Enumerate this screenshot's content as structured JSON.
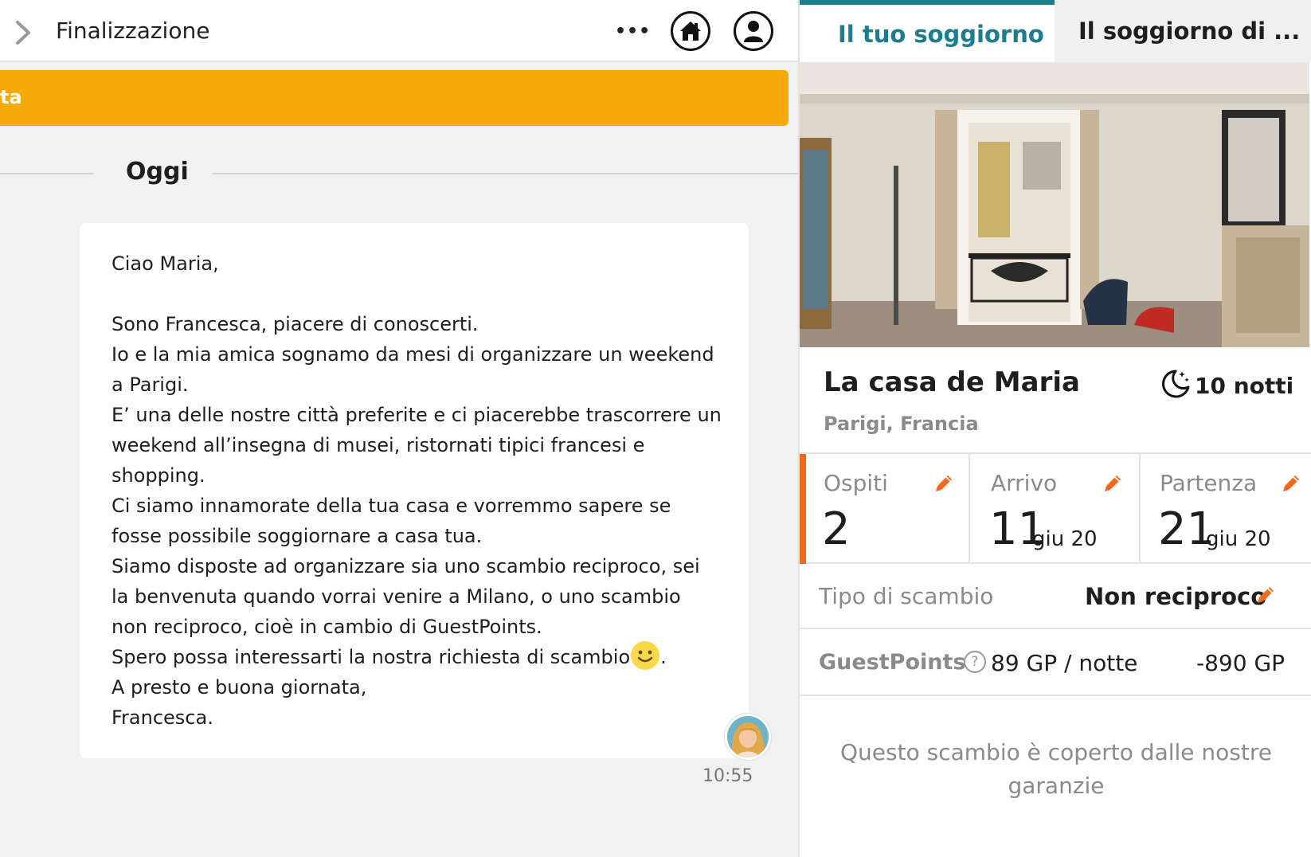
{
  "header": {
    "title": "Finalizzazione",
    "more_label": "•••",
    "home_icon": "home-icon",
    "profile_icon": "user-icon"
  },
  "alert": {
    "text": "ta",
    "color": "#f5a90a"
  },
  "conversation": {
    "day_label": "Oggi",
    "message": {
      "lines": [
        "Ciao Maria,",
        "",
        "Sono Francesca, piacere di conoscerti.",
        "Io e la mia amica sognamo da mesi di organizzare un weekend",
        "a Parigi.",
        "E’ una delle nostre città preferite e ci piacerebbe trascorrere un",
        "weekend all’insegna di musei, ristornati tipici francesi e",
        "shopping.",
        "Ci siamo innamorate della tua casa e vorremmo sapere se",
        "fosse possibile soggiornare a casa tua.",
        "Siamo disposte ad organizzare sia uno scambio reciproco, sei",
        "la benvenuta quando vorrai venire a Milano, o uno scambio",
        "non reciproco, cioè in cambio di GuestPoints.",
        "Spero possa interessarti la nostra richiesta di scambio",
        "A presto e buona giornata,",
        "Francesca."
      ],
      "emoji_after_line": ".",
      "time": "10:55"
    }
  },
  "tabs": [
    {
      "label": "Il tuo soggiorno",
      "active": true
    },
    {
      "label": "Il soggiorno di ..."
    }
  ],
  "stay": {
    "title": "La casa de Maria",
    "location": "Parigi, Francia",
    "nights": "10 notti",
    "guests_label": "Ospiti",
    "guests_value": "2",
    "arrival_label": "Arrivo",
    "arrival_day": "11",
    "arrival_month": "giu 20",
    "departure_label": "Partenza",
    "departure_day": "21",
    "departure_month": "giu 20",
    "exchange_type_label": "Tipo di scambio",
    "exchange_type_value": "Non reciproco",
    "guestpoints_label": "GuestPoints",
    "guestpoints_help": "?",
    "guestpoints_rate": "89 GP / notte",
    "guestpoints_total": "-890 GP",
    "guarantee_text": "Questo scambio è coperto dalle nostre garanzie"
  },
  "colors": {
    "accent_teal": "#1a7e8f",
    "accent_orange": "#f06a1c",
    "alert_yellow": "#f5a90a"
  }
}
